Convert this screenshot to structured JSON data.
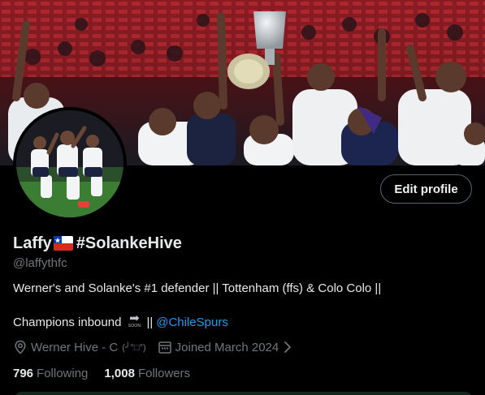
{
  "profile": {
    "display_name": "Laffy",
    "display_name_suffix": "#SolankeHive",
    "flag_name": "chile-flag",
    "handle": "@laffythfc",
    "bio": {
      "line1": "Werner's and Solanke's #1 defender || Tottenham (ffs) & Colo Colo ||",
      "line2_prefix": "Champions inbound",
      "emoji_arrow": "➡",
      "emoji_caption": "SOON",
      "line2_sep": "||",
      "mention": "@ChileSpurs"
    },
    "location": "Werner Hive - C",
    "location_emoticon": "(╯°□°)",
    "joined": "Joined March 2024",
    "following_count": "796",
    "following_label": "Following",
    "followers_count": "1,008",
    "followers_label": "Followers"
  },
  "actions": {
    "edit_profile_label": "Edit profile"
  },
  "icons": {
    "location": "location-pin-icon",
    "calendar": "calendar-icon",
    "chevron": "chevron-right-icon"
  },
  "colors": {
    "background": "#000000",
    "primary_text": "#e7e9ea",
    "secondary_text": "#71767b",
    "link": "#1d9bf0",
    "button_border": "#536471"
  }
}
